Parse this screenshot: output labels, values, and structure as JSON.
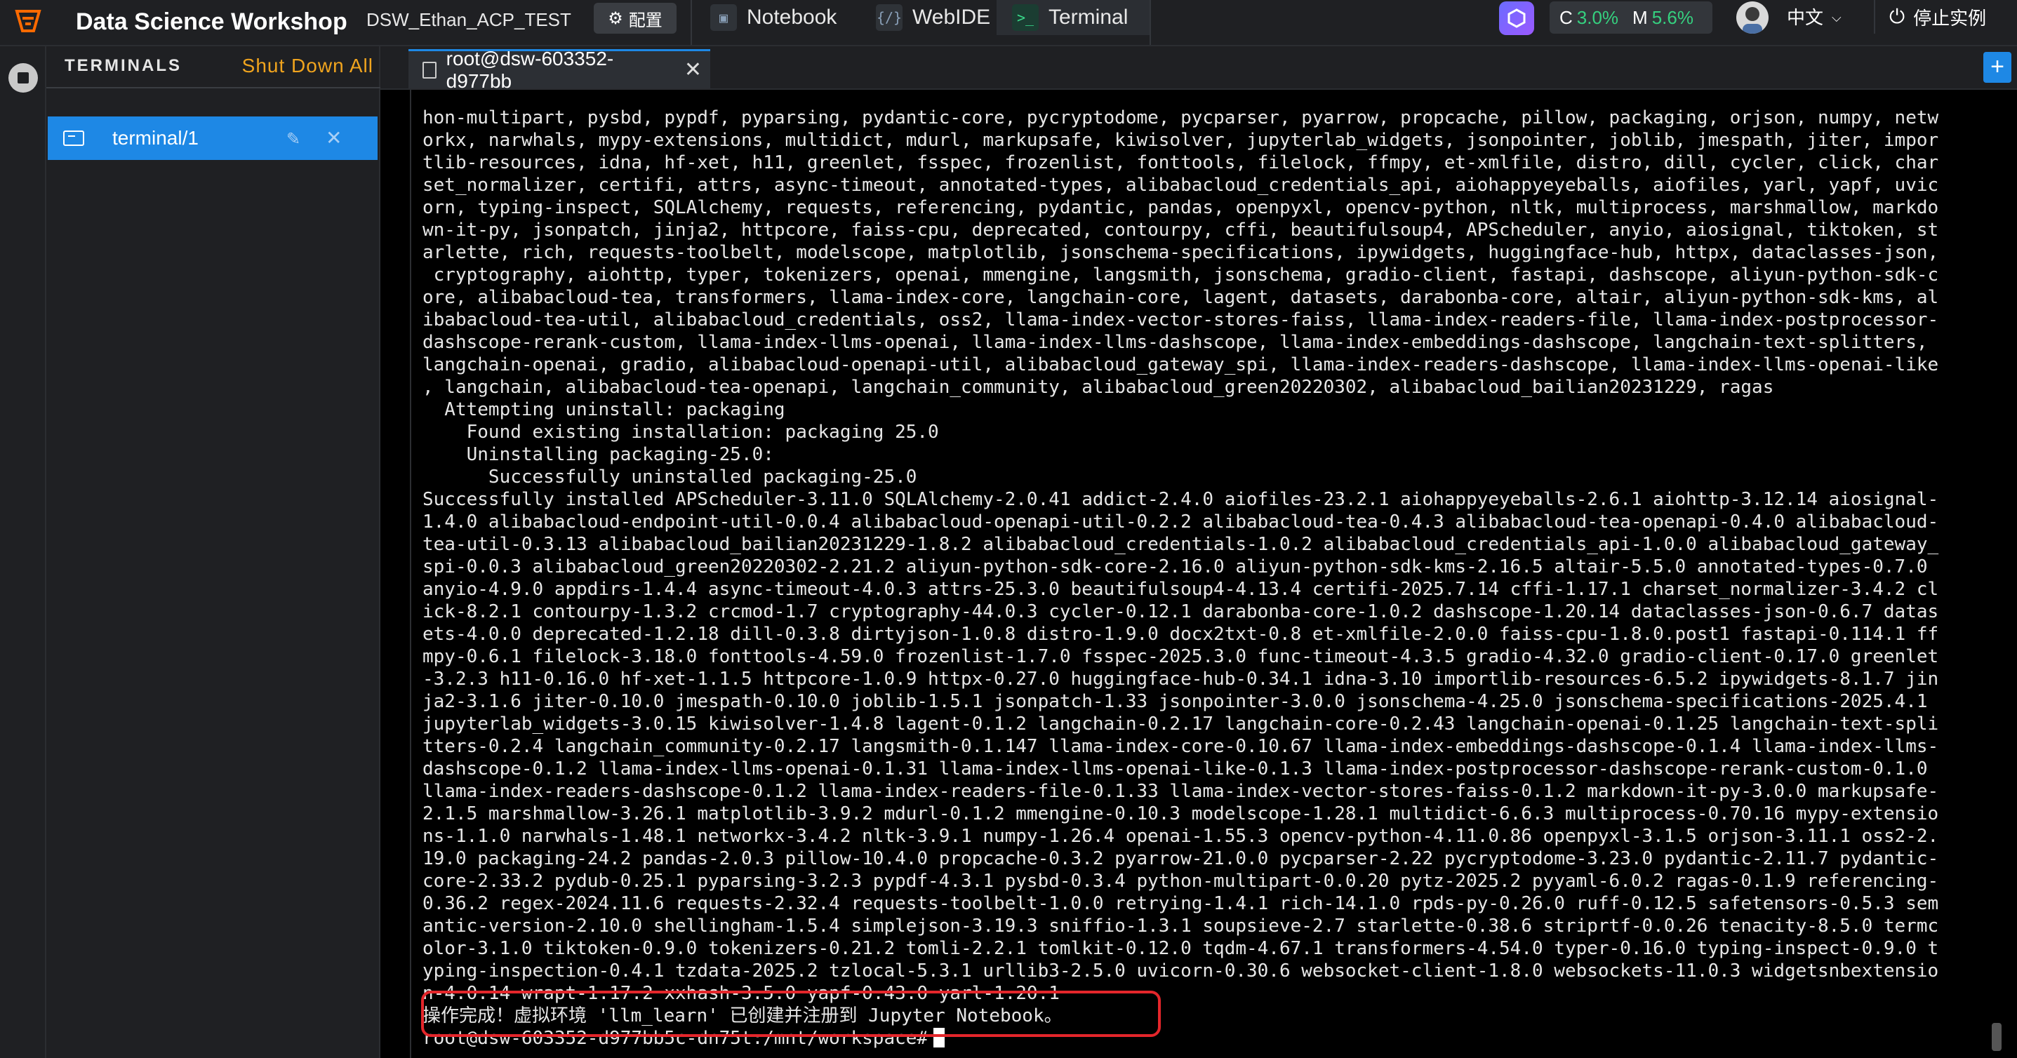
{
  "header": {
    "app_title": "Data Science Workshop",
    "workspace": "DSW_Ethan_ACP_TEST",
    "config_label": "配置",
    "tabs": [
      {
        "label": "Notebook",
        "icon": "notebook-icon"
      },
      {
        "label": "WebIDE",
        "icon": "code-icon"
      },
      {
        "label": "Terminal",
        "icon": "terminal-icon"
      }
    ],
    "metrics": {
      "cpu_label": "C",
      "cpu_value": "3.0%",
      "mem_label": "M",
      "mem_value": "5.6%"
    },
    "language": "中文",
    "stop_label": "停止实例",
    "colors": {
      "accent": "#1e88e5",
      "shutdown": "#f0a41e",
      "metric": "#35d07f",
      "highlight": "#e4262b"
    }
  },
  "sidebar": {
    "title": "TERMINALS",
    "shutdown_all": "Shut Down All",
    "items": [
      {
        "label": "terminal/1"
      }
    ]
  },
  "main": {
    "tab_label": "root@dsw-603352-d977bb",
    "terminal_lines": [
      "hon-multipart, pysbd, pypdf, pyparsing, pydantic-core, pycryptodome, pycparser, pyarrow, propcache, pillow, packaging, orjson, numpy, netw",
      "orkx, narwhals, mypy-extensions, multidict, mdurl, markupsafe, kiwisolver, jupyterlab_widgets, jsonpointer, joblib, jmespath, jiter, impor",
      "tlib-resources, idna, hf-xet, h11, greenlet, fsspec, frozenlist, fonttools, filelock, ffmpy, et-xmlfile, distro, dill, cycler, click, char",
      "set_normalizer, certifi, attrs, async-timeout, annotated-types, alibabacloud_credentials_api, aiohappyeyeballs, aiofiles, yarl, yapf, uvic",
      "orn, typing-inspect, SQLAlchemy, requests, referencing, pydantic, pandas, openpyxl, opencv-python, nltk, multiprocess, marshmallow, markdo",
      "wn-it-py, jsonpatch, jinja2, httpcore, faiss-cpu, deprecated, contourpy, cffi, beautifulsoup4, APScheduler, anyio, aiosignal, tiktoken, st",
      "arlette, rich, requests-toolbelt, modelscope, matplotlib, jsonschema-specifications, ipywidgets, huggingface-hub, httpx, dataclasses-json,",
      " cryptography, aiohttp, typer, tokenizers, openai, mmengine, langsmith, jsonschema, gradio-client, fastapi, dashscope, aliyun-python-sdk-c",
      "ore, alibabacloud-tea, transformers, llama-index-core, langchain-core, lagent, datasets, darabonba-core, altair, aliyun-python-sdk-kms, al",
      "ibabacloud-tea-util, alibabacloud_credentials, oss2, llama-index-vector-stores-faiss, llama-index-readers-file, llama-index-postprocessor-",
      "dashscope-rerank-custom, llama-index-llms-openai, llama-index-llms-dashscope, llama-index-embeddings-dashscope, langchain-text-splitters,",
      "langchain-openai, gradio, alibabacloud-openapi-util, alibabacloud_gateway_spi, llama-index-readers-dashscope, llama-index-llms-openai-like",
      ", langchain, alibabacloud-tea-openapi, langchain_community, alibabacloud_green20220302, alibabacloud_bailian20231229, ragas",
      "  Attempting uninstall: packaging",
      "    Found existing installation: packaging 25.0",
      "    Uninstalling packaging-25.0:",
      "      Successfully uninstalled packaging-25.0",
      "Successfully installed APScheduler-3.11.0 SQLAlchemy-2.0.41 addict-2.4.0 aiofiles-23.2.1 aiohappyeyeballs-2.6.1 aiohttp-3.12.14 aiosignal-",
      "1.4.0 alibabacloud-endpoint-util-0.0.4 alibabacloud-openapi-util-0.2.2 alibabacloud-tea-0.4.3 alibabacloud-tea-openapi-0.4.0 alibabacloud-",
      "tea-util-0.3.13 alibabacloud_bailian20231229-1.8.2 alibabacloud_credentials-1.0.2 alibabacloud_credentials_api-1.0.0 alibabacloud_gateway_",
      "spi-0.0.3 alibabacloud_green20220302-2.21.2 aliyun-python-sdk-core-2.16.0 aliyun-python-sdk-kms-2.16.5 altair-5.5.0 annotated-types-0.7.0",
      "anyio-4.9.0 appdirs-1.4.4 async-timeout-4.0.3 attrs-25.3.0 beautifulsoup4-4.13.4 certifi-2025.7.14 cffi-1.17.1 charset_normalizer-3.4.2 cl",
      "ick-8.2.1 contourpy-1.3.2 crcmod-1.7 cryptography-44.0.3 cycler-0.12.1 darabonba-core-1.0.2 dashscope-1.20.14 dataclasses-json-0.6.7 datas",
      "ets-4.0.0 deprecated-1.2.18 dill-0.3.8 dirtyjson-1.0.8 distro-1.9.0 docx2txt-0.8 et-xmlfile-2.0.0 faiss-cpu-1.8.0.post1 fastapi-0.114.1 ff",
      "mpy-0.6.1 filelock-3.18.0 fonttools-4.59.0 frozenlist-1.7.0 fsspec-2025.3.0 func-timeout-4.3.5 gradio-4.32.0 gradio-client-0.17.0 greenlet",
      "-3.2.3 h11-0.16.0 hf-xet-1.1.5 httpcore-1.0.9 httpx-0.27.0 huggingface-hub-0.34.1 idna-3.10 importlib-resources-6.5.2 ipywidgets-8.1.7 jin",
      "ja2-3.1.6 jiter-0.10.0 jmespath-0.10.0 joblib-1.5.1 jsonpatch-1.33 jsonpointer-3.0.0 jsonschema-4.25.0 jsonschema-specifications-2025.4.1",
      "jupyterlab_widgets-3.0.15 kiwisolver-1.4.8 lagent-0.1.2 langchain-0.2.17 langchain-core-0.2.43 langchain-openai-0.1.25 langchain-text-spli",
      "tters-0.2.4 langchain_community-0.2.17 langsmith-0.1.147 llama-index-core-0.10.67 llama-index-embeddings-dashscope-0.1.4 llama-index-llms-",
      "dashscope-0.1.2 llama-index-llms-openai-0.1.31 llama-index-llms-openai-like-0.1.3 llama-index-postprocessor-dashscope-rerank-custom-0.1.0",
      "llama-index-readers-dashscope-0.1.2 llama-index-readers-file-0.1.33 llama-index-vector-stores-faiss-0.1.2 markdown-it-py-3.0.0 markupsafe-",
      "2.1.5 marshmallow-3.26.1 matplotlib-3.9.2 mdurl-0.1.2 mmengine-0.10.3 modelscope-1.28.1 multidict-6.6.3 multiprocess-0.70.16 mypy-extensio",
      "ns-1.1.0 narwhals-1.48.1 networkx-3.4.2 nltk-3.9.1 numpy-1.26.4 openai-1.55.3 opencv-python-4.11.0.86 openpyxl-3.1.5 orjson-3.11.1 oss2-2.",
      "19.0 packaging-24.2 pandas-2.0.3 pillow-10.4.0 propcache-0.3.2 pyarrow-21.0.0 pycparser-2.22 pycryptodome-3.23.0 pydantic-2.11.7 pydantic-",
      "core-2.33.2 pydub-0.25.1 pyparsing-3.2.3 pypdf-4.3.1 pysbd-0.3.4 python-multipart-0.0.20 pytz-2025.2 pyyaml-6.0.2 ragas-0.1.9 referencing-",
      "0.36.2 regex-2024.11.6 requests-2.32.4 requests-toolbelt-1.0.0 retrying-1.4.1 rich-14.1.0 rpds-py-0.26.0 ruff-0.12.5 safetensors-0.5.3 sem",
      "antic-version-2.10.0 shellingham-1.5.4 simplejson-3.19.3 sniffio-1.3.1 soupsieve-2.7 starlette-0.38.6 striprtf-0.0.26 tenacity-8.5.0 termc",
      "olor-3.1.0 tiktoken-0.9.0 tokenizers-0.21.2 tomli-2.2.1 tomlkit-0.12.0 tqdm-4.67.1 transformers-4.54.0 typer-0.16.0 typing-inspect-0.9.0 t",
      "yping-inspection-0.4.1 tzdata-2025.2 tzlocal-5.3.1 urllib3-2.5.0 uvicorn-0.30.6 websocket-client-1.8.0 websockets-11.0.3 widgetsnbextensio",
      "n-4.0.14 wrapt-1.17.2 xxhash-3.5.0 yapf-0.43.0 yarl-1.20.1",
      "操作完成！虚拟环境 'llm_learn' 已创建并注册到 Jupyter Notebook。",
      "root@dsw-603352-d977bb5c-dn75t:/mnt/workspace#"
    ]
  }
}
